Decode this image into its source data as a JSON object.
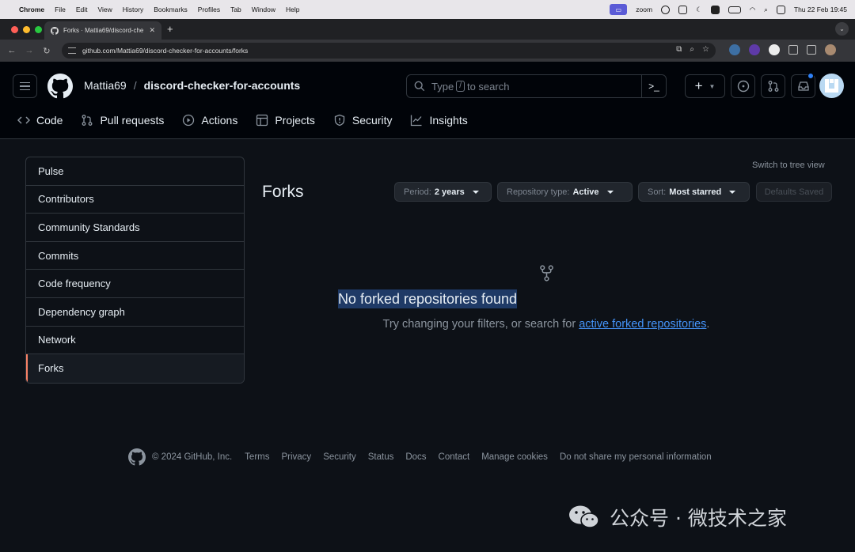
{
  "os_menubar": {
    "app": "Chrome",
    "items": [
      "File",
      "Edit",
      "View",
      "History",
      "Bookmarks",
      "Profiles",
      "Tab",
      "Window",
      "Help"
    ],
    "zoom_label": "zoom",
    "datetime": "Thu 22 Feb  19:45"
  },
  "browser": {
    "tab_title": "Forks · Mattia69/discord-che",
    "url": "github.com/Mattia69/discord-checker-for-accounts/forks"
  },
  "header": {
    "owner": "Mattia69",
    "separator": "/",
    "repo": "discord-checker-for-accounts",
    "search_prefix": "Type",
    "search_key": "/",
    "search_suffix": "to search"
  },
  "repo_nav": [
    {
      "label": "Code",
      "icon": "code-icon"
    },
    {
      "label": "Pull requests",
      "icon": "pull-request-icon"
    },
    {
      "label": "Actions",
      "icon": "play-icon"
    },
    {
      "label": "Projects",
      "icon": "table-icon"
    },
    {
      "label": "Security",
      "icon": "shield-icon"
    },
    {
      "label": "Insights",
      "icon": "graph-icon"
    }
  ],
  "sidebar": {
    "items": [
      {
        "label": "Pulse"
      },
      {
        "label": "Contributors"
      },
      {
        "label": "Community Standards"
      },
      {
        "label": "Commits"
      },
      {
        "label": "Code frequency"
      },
      {
        "label": "Dependency graph"
      },
      {
        "label": "Network"
      },
      {
        "label": "Forks"
      }
    ],
    "active": "Forks"
  },
  "main": {
    "switch_view": "Switch to tree view",
    "title": "Forks",
    "filters": {
      "period_label": "Period:",
      "period_value": "2 years",
      "type_label": "Repository type:",
      "type_value": "Active",
      "sort_label": "Sort:",
      "sort_value": "Most starred"
    },
    "defaults_button": "Defaults Saved",
    "empty_title": "No forked repositories found",
    "empty_sub_prefix": "Try changing your filters, or search for",
    "empty_link": "active forked repositories",
    "empty_sub_suffix": "."
  },
  "footer": {
    "copyright": "© 2024 GitHub, Inc.",
    "links": [
      "Terms",
      "Privacy",
      "Security",
      "Status",
      "Docs",
      "Contact",
      "Manage cookies",
      "Do not share my personal information"
    ]
  },
  "watermark": "公众号 · 微技术之家"
}
